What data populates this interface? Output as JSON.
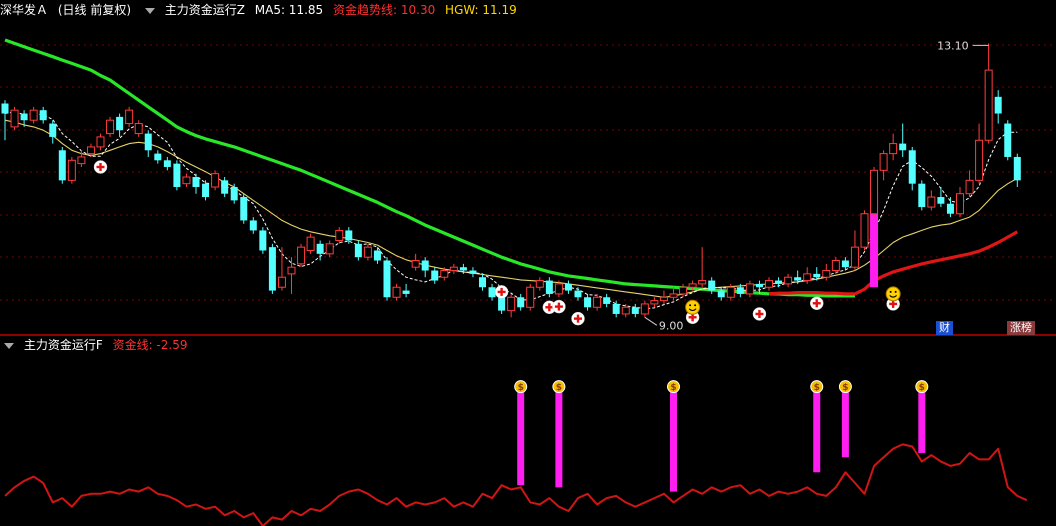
{
  "main_header": {
    "stock": "深华发Ａ",
    "period": "(日线 前复权)",
    "indicator": "主力资金运行Z",
    "ma5_label": "MA5: 11.85",
    "trend_label": "资金趋势线: 10.30",
    "hgw_label": "HGW: 11.19"
  },
  "sub_header": {
    "indicator": "主力资金运行F",
    "money_label": "资金线: -2.59"
  },
  "badges": {
    "cai": "财",
    "zhangbang": "涨榜"
  },
  "colors": {
    "up": "#ff3c3c",
    "down": "#54ffff",
    "grid": "#7a0000",
    "ma_yellow": "#e6d36a",
    "ma_green": "#28e628",
    "trend_red": "#e01616",
    "magenta": "#ff1ef0",
    "panel_line": "#d01515",
    "header_white": "#dddddd",
    "header_red": "#ff3030",
    "header_yellow": "#ffd700",
    "badge_blue": "#1a4fd6",
    "badge_brown": "#8a3a3a"
  },
  "chart_data": {
    "type": "candlestick",
    "price_range": [
      8.75,
      13.45
    ],
    "high_label": "13.10",
    "low_label": "9.00",
    "candles": [
      [
        12.2,
        12.05,
        12.25,
        11.65
      ],
      [
        11.85,
        12.1,
        12.15,
        11.8
      ],
      [
        12.05,
        11.95,
        12.1,
        11.85
      ],
      [
        11.95,
        12.1,
        12.15,
        11.9
      ],
      [
        12.1,
        11.95,
        12.15,
        11.9
      ],
      [
        11.9,
        11.7,
        11.95,
        11.6
      ],
      [
        11.5,
        11.05,
        11.55,
        11.0
      ],
      [
        11.05,
        11.35,
        11.4,
        11.0
      ],
      [
        11.3,
        11.4,
        11.5,
        11.25
      ],
      [
        11.45,
        11.55,
        11.6,
        11.4
      ],
      [
        11.55,
        11.7,
        11.75,
        11.5
      ],
      [
        11.75,
        11.95,
        12.0,
        11.7
      ],
      [
        12.0,
        11.8,
        12.05,
        11.7
      ],
      [
        11.9,
        12.1,
        12.15,
        11.85
      ],
      [
        11.75,
        11.9,
        11.95,
        11.7
      ],
      [
        11.75,
        11.5,
        11.8,
        11.4
      ],
      [
        11.45,
        11.35,
        11.5,
        11.3
      ],
      [
        11.35,
        11.25,
        11.4,
        11.2
      ],
      [
        11.3,
        10.95,
        11.35,
        10.9
      ],
      [
        11.0,
        11.1,
        11.15,
        10.95
      ],
      [
        11.1,
        10.95,
        11.15,
        10.85
      ],
      [
        11.0,
        10.8,
        11.05,
        10.75
      ],
      [
        10.95,
        11.15,
        11.2,
        10.9
      ],
      [
        11.05,
        10.85,
        11.1,
        10.8
      ],
      [
        10.95,
        10.75,
        11.0,
        10.7
      ],
      [
        10.8,
        10.45,
        10.85,
        10.4
      ],
      [
        10.45,
        10.3,
        10.5,
        10.25
      ],
      [
        10.3,
        10.0,
        10.35,
        9.95
      ],
      [
        10.05,
        9.4,
        10.1,
        9.35
      ],
      [
        9.45,
        9.6,
        10.05,
        9.4
      ],
      [
        9.65,
        9.75,
        9.9,
        9.35
      ],
      [
        9.8,
        10.05,
        10.1,
        9.75
      ],
      [
        10.0,
        10.2,
        10.25,
        9.95
      ],
      [
        10.1,
        9.95,
        10.15,
        9.85
      ],
      [
        9.95,
        10.1,
        10.15,
        9.9
      ],
      [
        10.15,
        10.3,
        10.35,
        10.1
      ],
      [
        10.3,
        10.15,
        10.35,
        10.1
      ],
      [
        10.1,
        9.9,
        10.15,
        9.85
      ],
      [
        9.9,
        10.05,
        10.1,
        9.85
      ],
      [
        10.0,
        9.85,
        10.05,
        9.8
      ],
      [
        9.85,
        9.3,
        9.9,
        9.25
      ],
      [
        9.3,
        9.45,
        9.5,
        9.25
      ],
      [
        9.4,
        9.35,
        9.5,
        9.3
      ],
      [
        9.75,
        9.85,
        9.95,
        9.7
      ],
      [
        9.85,
        9.7,
        9.9,
        9.6
      ],
      [
        9.7,
        9.55,
        9.75,
        9.5
      ],
      [
        9.6,
        9.7,
        9.75,
        9.55
      ],
      [
        9.7,
        9.75,
        9.8,
        9.65
      ],
      [
        9.75,
        9.7,
        9.8,
        9.65
      ],
      [
        9.7,
        9.65,
        9.75,
        9.6
      ],
      [
        9.6,
        9.45,
        9.65,
        9.4
      ],
      [
        9.45,
        9.3,
        9.5,
        9.25
      ],
      [
        9.3,
        9.1,
        9.35,
        9.05
      ],
      [
        9.1,
        9.3,
        9.35,
        9.0
      ],
      [
        9.3,
        9.15,
        9.35,
        9.1
      ],
      [
        9.15,
        9.45,
        9.5,
        9.1
      ],
      [
        9.45,
        9.55,
        9.6,
        9.4
      ],
      [
        9.55,
        9.35,
        9.6,
        9.3
      ],
      [
        9.35,
        9.5,
        9.55,
        9.3
      ],
      [
        9.5,
        9.4,
        9.55,
        9.35
      ],
      [
        9.4,
        9.3,
        9.45,
        9.25
      ],
      [
        9.3,
        9.15,
        9.35,
        9.1
      ],
      [
        9.15,
        9.3,
        9.35,
        9.1
      ],
      [
        9.3,
        9.2,
        9.35,
        9.15
      ],
      [
        9.2,
        9.05,
        9.25,
        9.0
      ],
      [
        9.05,
        9.15,
        9.2,
        9.0
      ],
      [
        9.15,
        9.05,
        9.2,
        9.0
      ],
      [
        9.05,
        9.2,
        9.25,
        9.0
      ],
      [
        9.2,
        9.25,
        9.3,
        9.15
      ],
      [
        9.25,
        9.3,
        9.4,
        9.2
      ],
      [
        9.3,
        9.35,
        9.45,
        9.25
      ],
      [
        9.35,
        9.45,
        9.5,
        9.3
      ],
      [
        9.45,
        9.5,
        9.55,
        9.4
      ],
      [
        9.5,
        9.55,
        10.05,
        9.45
      ],
      [
        9.55,
        9.4,
        9.6,
        9.35
      ],
      [
        9.4,
        9.3,
        9.45,
        9.25
      ],
      [
        9.3,
        9.45,
        9.5,
        9.25
      ],
      [
        9.45,
        9.35,
        9.5,
        9.3
      ],
      [
        9.35,
        9.5,
        9.55,
        9.3
      ],
      [
        9.5,
        9.45,
        9.55,
        9.35
      ],
      [
        9.45,
        9.55,
        9.6,
        9.4
      ],
      [
        9.55,
        9.5,
        9.6,
        9.45
      ],
      [
        9.5,
        9.6,
        9.65,
        9.45
      ],
      [
        9.6,
        9.55,
        9.7,
        9.5
      ],
      [
        9.55,
        9.65,
        9.75,
        9.5
      ],
      [
        9.65,
        9.6,
        9.75,
        9.55
      ],
      [
        9.6,
        9.7,
        9.8,
        9.55
      ],
      [
        9.7,
        9.85,
        9.9,
        9.65
      ],
      [
        9.85,
        9.75,
        9.9,
        9.7
      ],
      [
        9.75,
        10.05,
        10.3,
        9.7
      ],
      [
        10.05,
        10.55,
        10.6,
        10.0
      ],
      [
        10.55,
        11.2,
        11.25,
        10.5
      ],
      [
        11.2,
        11.45,
        11.5,
        11.05
      ],
      [
        11.45,
        11.6,
        11.75,
        11.35
      ],
      [
        11.6,
        11.5,
        11.9,
        11.4
      ],
      [
        11.5,
        11.0,
        11.55,
        10.9
      ],
      [
        11.0,
        10.65,
        11.05,
        10.6
      ],
      [
        10.65,
        10.8,
        10.9,
        10.6
      ],
      [
        10.8,
        10.7,
        10.95,
        10.65
      ],
      [
        10.7,
        10.55,
        10.8,
        10.5
      ],
      [
        10.55,
        10.85,
        10.95,
        10.5
      ],
      [
        10.85,
        11.05,
        11.2,
        10.8
      ],
      [
        11.05,
        11.65,
        11.9,
        11.0
      ],
      [
        11.65,
        12.7,
        13.1,
        11.6
      ],
      [
        12.3,
        12.05,
        12.4,
        11.9
      ],
      [
        11.9,
        11.4,
        11.95,
        11.35
      ],
      [
        11.4,
        11.05,
        11.45,
        10.95
      ]
    ],
    "ma_yellow": [
      11.95,
      11.92,
      11.88,
      11.85,
      11.8,
      11.72,
      11.6,
      11.5,
      11.45,
      11.42,
      11.45,
      11.5,
      11.55,
      11.6,
      11.62,
      11.6,
      11.55,
      11.48,
      11.4,
      11.32,
      11.25,
      11.18,
      11.1,
      11.02,
      10.95,
      10.85,
      10.75,
      10.65,
      10.55,
      10.45,
      10.38,
      10.32,
      10.28,
      10.25,
      10.22,
      10.2,
      10.18,
      10.15,
      10.12,
      10.08,
      10.0,
      9.92,
      9.86,
      9.82,
      9.78,
      9.75,
      9.72,
      9.7,
      9.68,
      9.66,
      9.64,
      9.62,
      9.6,
      9.58,
      9.56,
      9.55,
      9.54,
      9.53,
      9.52,
      9.5,
      9.48,
      9.46,
      9.44,
      9.42,
      9.4,
      9.38,
      9.36,
      9.34,
      9.32,
      9.3,
      9.32,
      9.35,
      9.38,
      9.42,
      9.44,
      9.45,
      9.46,
      9.47,
      9.48,
      9.49,
      9.5,
      9.51,
      9.52,
      9.53,
      9.55,
      9.57,
      9.6,
      9.63,
      9.66,
      9.7,
      9.78,
      9.88,
      10.0,
      10.12,
      10.2,
      10.25,
      10.3,
      10.35,
      10.38,
      10.4,
      10.45,
      10.5,
      10.6,
      10.75,
      10.9,
      11.0,
      11.08
    ],
    "ma_green": [
      13.15,
      13.1,
      13.05,
      13.0,
      12.95,
      12.9,
      12.85,
      12.8,
      12.75,
      12.7,
      12.62,
      12.55,
      12.45,
      12.35,
      12.25,
      12.15,
      12.05,
      11.95,
      11.85,
      11.78,
      11.72,
      11.67,
      11.63,
      11.59,
      11.55,
      11.5,
      11.45,
      11.4,
      11.35,
      11.3,
      11.25,
      11.2,
      11.14,
      11.08,
      11.02,
      10.96,
      10.9,
      10.84,
      10.78,
      10.72,
      10.65,
      10.58,
      10.52,
      10.45,
      10.38,
      10.32,
      10.26,
      10.2,
      10.14,
      10.08,
      10.02,
      9.96,
      9.9,
      9.85,
      9.8,
      9.76,
      9.72,
      9.68,
      9.65,
      9.62,
      9.6,
      9.58,
      9.56,
      9.54,
      9.52,
      9.5,
      9.49,
      9.48,
      9.47,
      9.46,
      9.45,
      9.44,
      9.43,
      9.42,
      9.41,
      9.4,
      9.39,
      9.38,
      9.37,
      9.36,
      9.35,
      9.35,
      9.34,
      9.34,
      9.33,
      9.33,
      9.32,
      9.32,
      9.32,
      9.32
    ],
    "trend_red_start": 80,
    "trend_red": [
      9.35,
      9.36,
      9.36,
      9.37,
      9.37,
      9.37,
      9.36,
      9.36,
      9.35,
      9.35,
      9.42,
      9.55,
      9.62,
      9.68,
      9.72,
      9.76,
      9.8,
      9.83,
      9.86,
      9.89,
      9.92,
      9.95,
      9.99,
      10.05,
      10.12,
      10.2,
      10.28
    ],
    "plus_signs": [
      [
        10,
        11.25
      ],
      [
        52,
        9.38
      ],
      [
        57,
        9.15
      ],
      [
        58,
        9.16
      ],
      [
        60,
        8.98
      ],
      [
        72,
        9.0
      ],
      [
        79,
        9.05
      ],
      [
        85,
        9.21
      ],
      [
        93,
        9.2
      ]
    ],
    "smileys": [
      [
        72,
        9.15
      ],
      [
        93,
        9.35
      ]
    ],
    "magenta_bar": {
      "index": 91,
      "top": 10.85,
      "bottom": 9.45
    },
    "sub_range": [
      -4.3,
      3.8
    ],
    "money_line": [
      -2.9,
      -2.5,
      -2.2,
      -2.0,
      -2.3,
      -3.2,
      -3.0,
      -3.4,
      -2.9,
      -2.8,
      -2.8,
      -2.7,
      -2.8,
      -2.6,
      -2.7,
      -2.5,
      -2.8,
      -2.9,
      -3.1,
      -3.4,
      -3.3,
      -3.5,
      -3.4,
      -3.8,
      -3.6,
      -3.9,
      -3.7,
      -4.3,
      -3.9,
      -4.0,
      -3.6,
      -3.8,
      -3.5,
      -3.6,
      -3.3,
      -2.9,
      -2.7,
      -2.6,
      -2.8,
      -3.1,
      -3.3,
      -3.0,
      -3.4,
      -3.2,
      -3.3,
      -3.2,
      -3.0,
      -3.4,
      -3.2,
      -3.4,
      -2.8,
      -3.0,
      -2.4,
      -2.6,
      -2.5,
      -3.2,
      -3.3,
      -3.0,
      -3.4,
      -3.6,
      -3.0,
      -2.8,
      -3.3,
      -3.0,
      -2.9,
      -3.2,
      -3.4,
      -3.2,
      -3.0,
      -2.8,
      -3.2,
      -2.9,
      -2.6,
      -2.8,
      -2.5,
      -2.7,
      -2.5,
      -2.4,
      -2.8,
      -2.6,
      -2.9,
      -2.7,
      -2.8,
      -2.7,
      -2.5,
      -2.8,
      -2.9,
      -2.5,
      -1.8,
      -2.3,
      -2.8,
      -1.5,
      -1.1,
      -0.7,
      -0.5,
      -0.6,
      -1.3,
      -1.0,
      -1.3,
      -1.5,
      -1.4,
      -0.9,
      -1.2,
      -1.2,
      -0.7,
      -2.5,
      -2.9,
      -3.1
    ],
    "money_bars": [
      [
        54,
        -2.4
      ],
      [
        58,
        -2.5
      ],
      [
        70,
        -2.7
      ],
      [
        85,
        -1.8
      ],
      [
        88,
        -1.1
      ],
      [
        96,
        -0.9
      ]
    ],
    "money_bar_top": 2.0
  }
}
